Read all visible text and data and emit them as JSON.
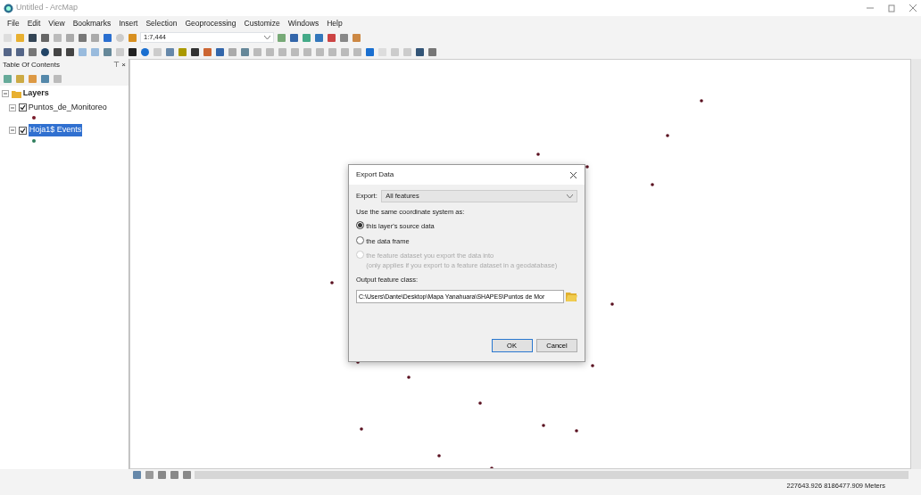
{
  "window": {
    "title": "Untitled - ArcMap"
  },
  "menu": [
    "File",
    "Edit",
    "View",
    "Bookmarks",
    "Insert",
    "Selection",
    "Geoprocessing",
    "Customize",
    "Windows",
    "Help"
  ],
  "toolbar": {
    "scale": "1:7,444"
  },
  "toc": {
    "title": "Table Of Contents",
    "pin": "⊤",
    "close": "×",
    "layers": {
      "label": "Layers",
      "expanded": true,
      "children": [
        {
          "label": "Puntos_de_Monitoreo",
          "checked": true,
          "selected": false,
          "expanded": true,
          "color": "#7a1a2a"
        },
        {
          "label": "Hoja1$ Events",
          "checked": true,
          "selected": true,
          "expanded": true,
          "color": "#2e7d5b"
        }
      ]
    }
  },
  "dialog": {
    "title": "Export Data",
    "export_label": "Export:",
    "export_value": "All features",
    "coord_label": "Use the same coordinate system as:",
    "options": [
      {
        "label": "this layer's source data",
        "selected": true,
        "disabled": false
      },
      {
        "label": "the data frame",
        "selected": false,
        "disabled": false
      },
      {
        "label": "the feature dataset you export the data into",
        "note": "(only applies if you export to a feature dataset in a geodatabase)",
        "selected": false,
        "disabled": true
      }
    ],
    "output_label": "Output feature class:",
    "output_value": "C:\\Users\\Dante\\Desktop\\Mapa Yanahuara\\SHAPES\\Puntos de Mor",
    "buttons": [
      {
        "label": "OK",
        "default": true
      },
      {
        "label": "Cancel",
        "default": false
      }
    ]
  },
  "status": {
    "coordinates": "227643.926  8186477.909 Meters"
  }
}
